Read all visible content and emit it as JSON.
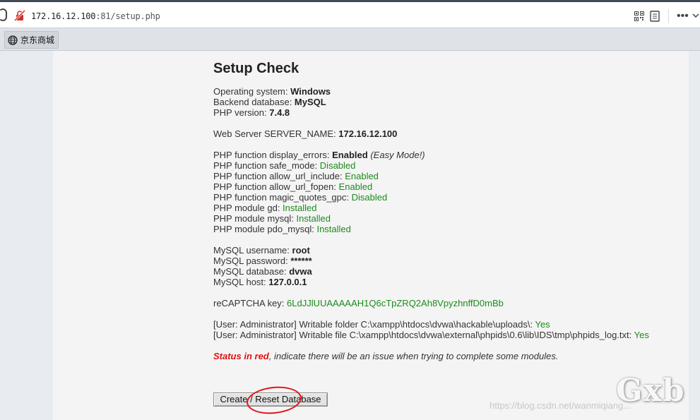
{
  "browser": {
    "url_host": "172.16.12.100",
    "url_rest": ":81/setup.php",
    "more_label": "•••"
  },
  "bookmarks": [
    {
      "label": "京东商城",
      "icon": "globe-icon"
    }
  ],
  "setup": {
    "title": "Setup Check",
    "system": [
      {
        "label": "Operating system: ",
        "value": "Windows"
      },
      {
        "label": "Backend database: ",
        "value": "MySQL"
      },
      {
        "label": "PHP version: ",
        "value": "7.4.8"
      }
    ],
    "server_name": {
      "label": "Web Server SERVER_NAME: ",
      "value": "172.16.12.100"
    },
    "display_errors": {
      "label": "PHP function display_errors: ",
      "value": "Enabled",
      "note": "(Easy Mode!)"
    },
    "php_checks": [
      {
        "label": "PHP function safe_mode: ",
        "value": "Disabled"
      },
      {
        "label": "PHP function allow_url_include: ",
        "value": "Enabled"
      },
      {
        "label": "PHP function allow_url_fopen: ",
        "value": "Enabled"
      },
      {
        "label": "PHP function magic_quotes_gpc: ",
        "value": "Disabled"
      },
      {
        "label": "PHP module gd: ",
        "value": "Installed"
      },
      {
        "label": "PHP module mysql: ",
        "value": "Installed"
      },
      {
        "label": "PHP module pdo_mysql: ",
        "value": "Installed"
      }
    ],
    "mysql": [
      {
        "label": "MySQL username: ",
        "value": "root"
      },
      {
        "label": "MySQL password: ",
        "value": "******"
      },
      {
        "label": "MySQL database: ",
        "value": "dvwa"
      },
      {
        "label": "MySQL host: ",
        "value": "127.0.0.1"
      }
    ],
    "recaptcha": {
      "label": "reCAPTCHA key: ",
      "value": "6LdJJlUUAAAAAH1Q6cTpZRQ2Ah8VpyzhnffD0mBb"
    },
    "writable": [
      {
        "label": "[User: Administrator] Writable folder C:\\xampp\\htdocs\\dvwa\\hackable\\uploads\\: ",
        "value": "Yes"
      },
      {
        "label": "[User: Administrator] Writable file C:\\xampp\\htdocs\\dvwa\\external\\phpids\\0.6\\lib\\IDS\\tmp\\phpids_log.txt: ",
        "value": "Yes"
      }
    ],
    "status_red": "Status in red",
    "status_text": ", indicate there will be an issue when trying to complete some modules.",
    "button_label": "Create / Reset Database"
  },
  "watermark": {
    "url": "https://blog.csdn.net/wanmiqiang...",
    "logo": "Gxb"
  },
  "colors": {
    "ok_green": "#1c8b1c",
    "status_red": "#e01010",
    "annotation_ring": "#e0161b"
  }
}
